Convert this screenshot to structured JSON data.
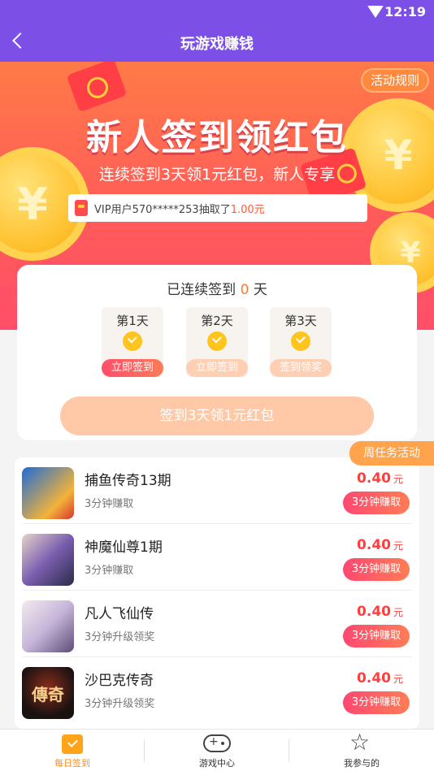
{
  "status": {
    "time": "12:19"
  },
  "header": {
    "title": "玩游戏赚钱"
  },
  "banner": {
    "rules": "活动规则",
    "headline": "新人签到领红包",
    "subline": "连续签到3天领1元红包，新人专享",
    "coin_symbol": "¥",
    "ticker_prefix": "VIP用户570*****253抽取了",
    "ticker_amount": "1.00元"
  },
  "signin": {
    "streak_prefix": "已连续签到",
    "streak_count": "0",
    "streak_suffix": "天",
    "days": [
      {
        "label": "第1天",
        "button": "立即签到"
      },
      {
        "label": "第2天",
        "button": "立即签到"
      },
      {
        "label": "第3天",
        "button": "签到领奖"
      }
    ],
    "main_button": "签到3天领1元红包"
  },
  "weekly": {
    "tag": "周任务活动"
  },
  "games": [
    {
      "name": "捕鱼传奇13期",
      "desc": "3分钟赚取",
      "price": "0.40",
      "unit": "元",
      "button": "3分钟赚取"
    },
    {
      "name": "神魔仙尊1期",
      "desc": "3分钟赚取",
      "price": "0.40",
      "unit": "元",
      "button": "3分钟赚取"
    },
    {
      "name": "凡人飞仙传",
      "desc": "3分钟升级领奖",
      "price": "0.40",
      "unit": "元",
      "button": "3分钟赚取"
    },
    {
      "name": "沙巴克传奇",
      "desc": "3分钟升级领奖",
      "price": "0.40",
      "unit": "元",
      "button": "3分钟赚取",
      "thumb_text": "傳奇"
    }
  ],
  "tabs": [
    {
      "label": "每日签到",
      "icon": "calendar-check-icon"
    },
    {
      "label": "游戏中心",
      "icon": "gamepad-icon"
    },
    {
      "label": "我参与的",
      "icon": "star-icon"
    }
  ],
  "colors": {
    "primary": "#7c50e6",
    "accent": "#ff8c1a",
    "price": "#ff3e3e"
  }
}
